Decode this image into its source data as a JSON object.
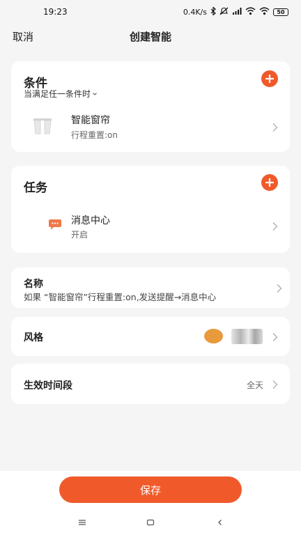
{
  "status_bar": {
    "time": "19:23",
    "network_speed": "0.4K/s",
    "icons": [
      "bluetooth-icon",
      "mute-icon",
      "hd-signal-icon",
      "wifi-icon",
      "wifi-icon"
    ],
    "battery": "50"
  },
  "header": {
    "cancel_label": "取消",
    "title": "创建智能"
  },
  "conditions": {
    "title": "条件",
    "mode": "当满足任一条件时",
    "items": [
      {
        "icon": "curtain-icon",
        "name": "智能窗帘",
        "detail": "行程重置:on"
      }
    ]
  },
  "tasks": {
    "title": "任务",
    "items": [
      {
        "icon": "message-icon",
        "name": "消息中心",
        "detail": "开启"
      }
    ]
  },
  "name_section": {
    "label": "名称",
    "value": "如果 “智能窗帘”行程重置:on,发送提醒→消息中心"
  },
  "style_section": {
    "label": "风格",
    "color": "#e89a3c"
  },
  "time_section": {
    "label": "生效时间段",
    "value": "全天"
  },
  "save_label": "保存",
  "colors": {
    "accent": "#f05a2b",
    "background": "#f5f5f5",
    "card": "#ffffff"
  },
  "nav_bar": [
    "menu-icon",
    "home-icon",
    "back-icon"
  ]
}
